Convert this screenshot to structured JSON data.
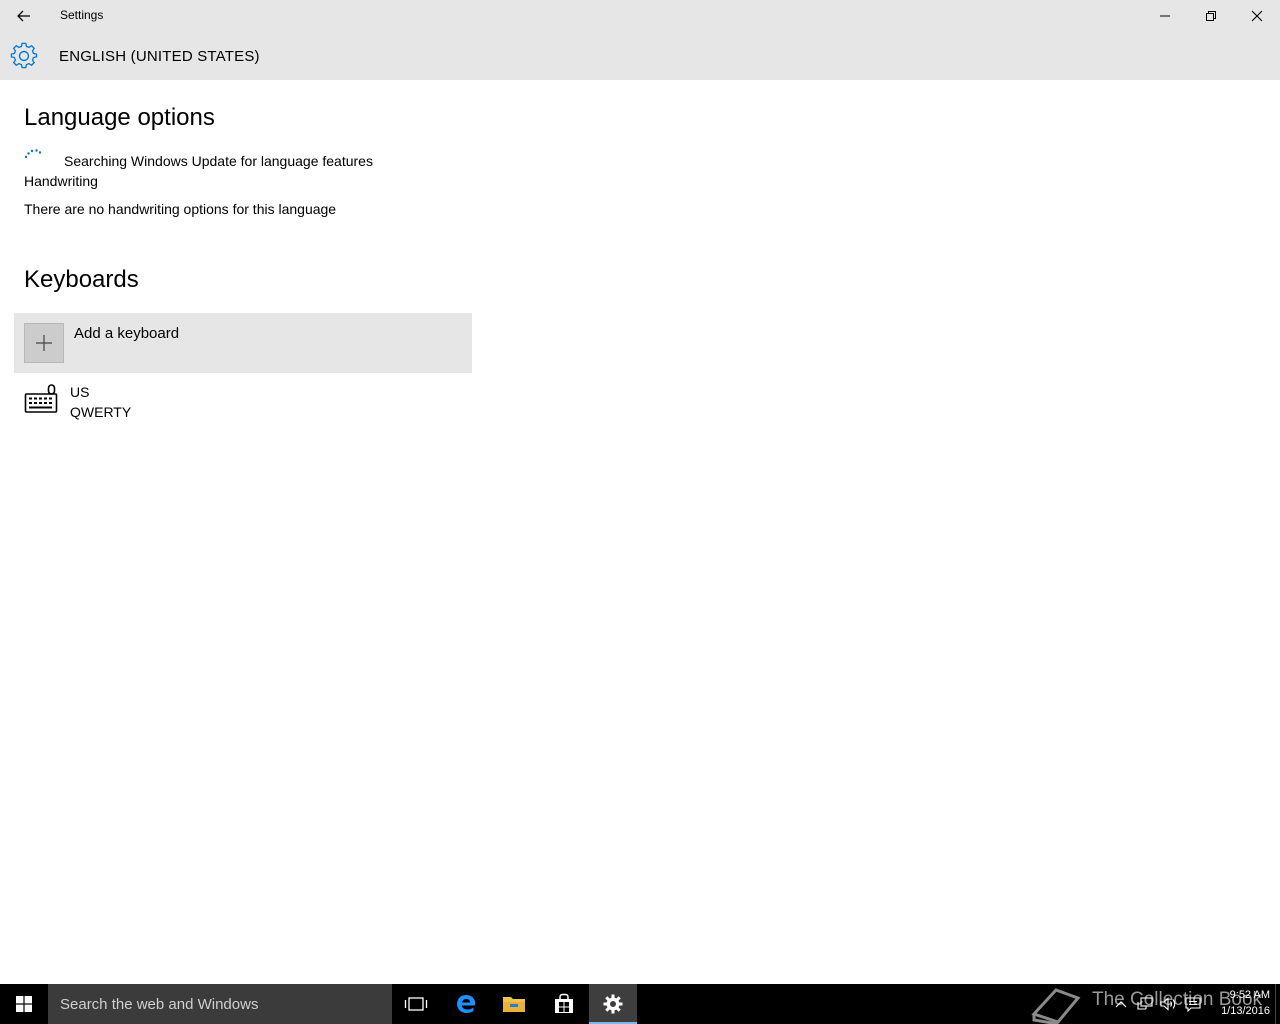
{
  "window": {
    "title": "Settings"
  },
  "header": {
    "title": "ENGLISH (UNITED STATES)"
  },
  "language_options": {
    "heading": "Language options",
    "status": "Searching Windows Update for language features",
    "handwriting_label": "Handwriting",
    "handwriting_text": "There are no handwriting options for this language"
  },
  "keyboards": {
    "heading": "Keyboards",
    "add_label": "Add a keyboard",
    "items": [
      {
        "name": "US",
        "layout": "QWERTY"
      }
    ]
  },
  "taskbar": {
    "search_placeholder": "Search the web and Windows",
    "apps": [
      "task-view-icon",
      "edge-icon",
      "file-explorer-icon",
      "store-icon",
      "settings-icon"
    ],
    "watermark": "The Collection Book",
    "clock_time": "9:52 AM",
    "clock_date": "1/13/2016"
  },
  "colors": {
    "chrome": "#e6e6e6",
    "accent": "#0078d7",
    "taskbar": "#000000",
    "search_box": "#3b3b3b"
  }
}
